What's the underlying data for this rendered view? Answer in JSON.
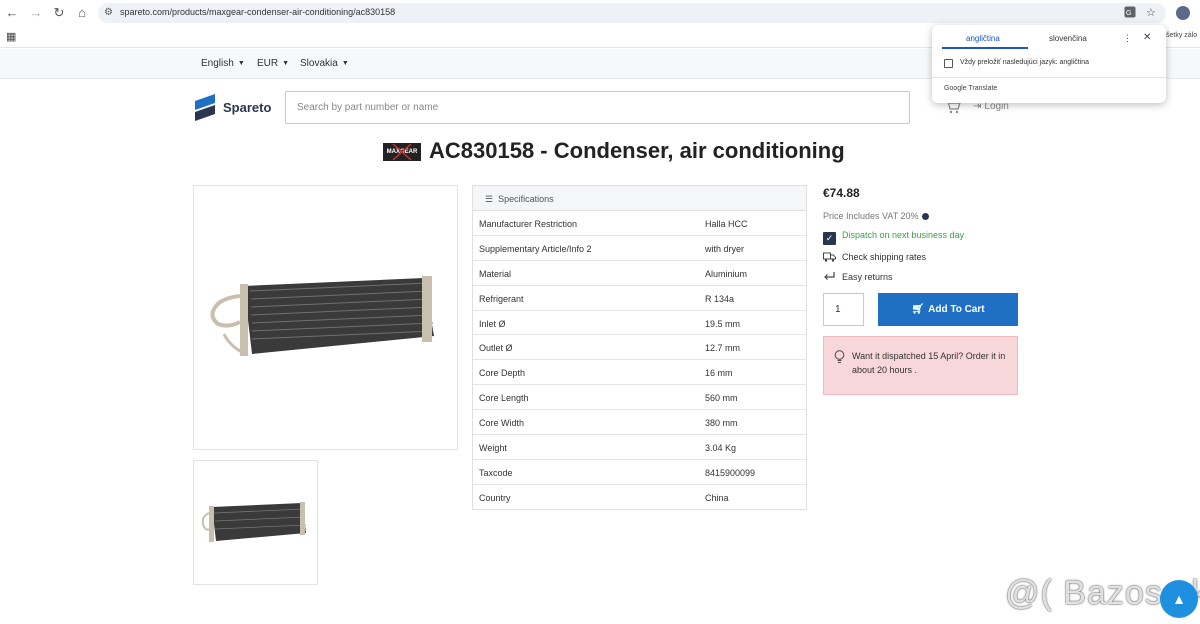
{
  "browser": {
    "url": "spareto.com/products/maxgear-condenser-air-conditioning/ac830158",
    "bookmarks_right": "šetky zálo"
  },
  "topbar": {
    "language": "English",
    "currency": "EUR",
    "country": "Slovakia"
  },
  "header": {
    "logo_text": "Spareto",
    "search_placeholder": "Search by part number or name",
    "login_label": "Login"
  },
  "product": {
    "brand_logo": "MAXGEAR",
    "title": "AC830158 - Condenser, air conditioning"
  },
  "specs": {
    "header": "Specifications",
    "rows": [
      {
        "key": "Manufacturer Restriction",
        "value": "Halla HCC"
      },
      {
        "key": "Supplementary Article/Info 2",
        "value": "with dryer"
      },
      {
        "key": "Material",
        "value": "Aluminium"
      },
      {
        "key": "Refrigerant",
        "value": "R 134a"
      },
      {
        "key": "Inlet Ø",
        "value": "19.5 mm"
      },
      {
        "key": "Outlet Ø",
        "value": "12.7 mm"
      },
      {
        "key": "Core Depth",
        "value": "16 mm"
      },
      {
        "key": "Core Length",
        "value": "560 mm"
      },
      {
        "key": "Core Width",
        "value": "380 mm"
      },
      {
        "key": "Weight",
        "value": "3.04 Kg"
      },
      {
        "key": "Taxcode",
        "value": "8415900099"
      },
      {
        "key": "Country",
        "value": "China"
      }
    ]
  },
  "purchase": {
    "price": "€74.88",
    "vat_note": "Price Includes VAT 20%",
    "dispatch": "Dispatch on next business day",
    "shipping": "Check shipping rates",
    "returns": "Easy returns",
    "quantity": "1",
    "add_to_cart": "Add To Cart",
    "alert_text": "Want it dispatched 15 April? Order it in about 20 hours ."
  },
  "translate": {
    "tab_active": "angličtina",
    "tab_other": "slovenčina",
    "always_translate": "Vždy preložiť nasledujúci jazyk: angličtina",
    "footer": "Google Translate"
  },
  "watermark": "@( Bazos.sk",
  "colors": {
    "accent_blue": "#1f6fc5",
    "brand_navy": "#2a3550",
    "success_green": "#3aa24a",
    "alert_pink": "#f8d7da"
  }
}
